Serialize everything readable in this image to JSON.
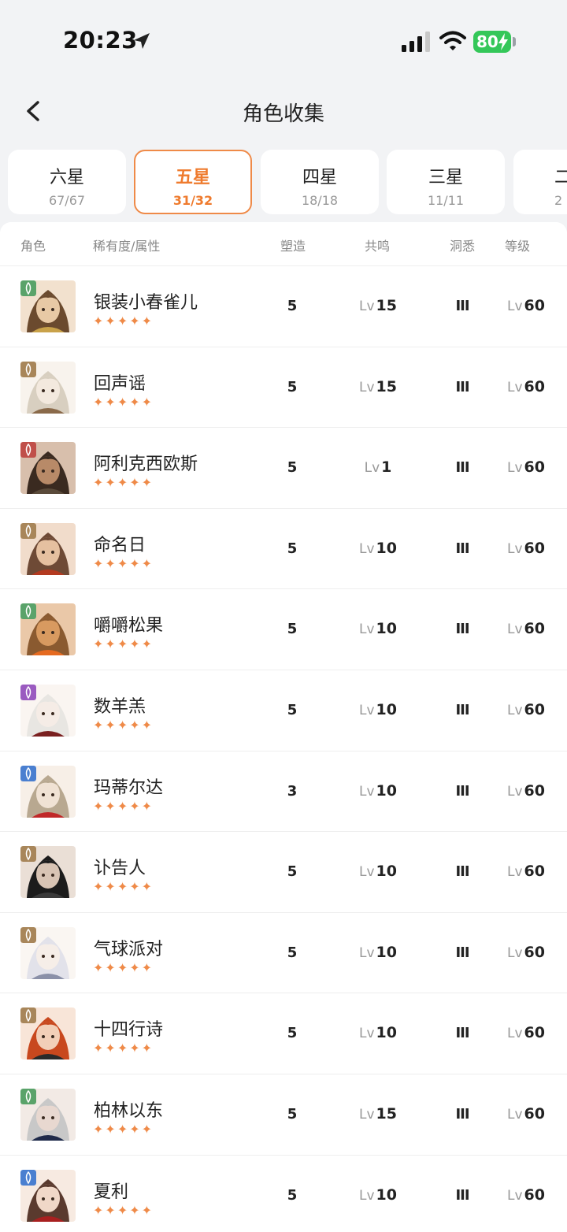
{
  "status_bar": {
    "time": "20:23",
    "battery": "80"
  },
  "nav": {
    "title": "角色收集"
  },
  "tabs": [
    {
      "label": "六星",
      "count": "67/67"
    },
    {
      "label": "五星",
      "count": "31/32"
    },
    {
      "label": "四星",
      "count": "18/18"
    },
    {
      "label": "三星",
      "count": "11/11"
    },
    {
      "label": "二",
      "count": "2"
    }
  ],
  "table": {
    "headers": {
      "role": "角色",
      "rarity": "稀有度/属性",
      "forge": "塑造",
      "resonance": "共鸣",
      "insight": "洞悉",
      "level": "等级"
    },
    "lv_prefix": "Lv",
    "rows": [
      {
        "name": "银装小春雀儿",
        "stars": "✦✦✦✦✦",
        "forge": "5",
        "resonance": "15",
        "insight": "III",
        "level": "60",
        "attribute": "plant",
        "attr_color": "#5aa36a"
      },
      {
        "name": "回声谣",
        "stars": "✦✦✦✦✦",
        "forge": "5",
        "resonance": "15",
        "insight": "III",
        "level": "60",
        "attribute": "mineral",
        "attr_color": "#a8865a"
      },
      {
        "name": "阿利克西欧斯",
        "stars": "✦✦✦✦✦",
        "forge": "5",
        "resonance": "1",
        "insight": "III",
        "level": "60",
        "attribute": "beast",
        "attr_color": "#c0504a"
      },
      {
        "name": "命名日",
        "stars": "✦✦✦✦✦",
        "forge": "5",
        "resonance": "10",
        "insight": "III",
        "level": "60",
        "attribute": "mineral",
        "attr_color": "#a8865a"
      },
      {
        "name": "嚼嚼松果",
        "stars": "✦✦✦✦✦",
        "forge": "5",
        "resonance": "10",
        "insight": "III",
        "level": "60",
        "attribute": "plant",
        "attr_color": "#5aa36a"
      },
      {
        "name": "数羊羔",
        "stars": "✦✦✦✦✦",
        "forge": "5",
        "resonance": "10",
        "insight": "III",
        "level": "60",
        "attribute": "spirit",
        "attr_color": "#9a5bc0"
      },
      {
        "name": "玛蒂尔达",
        "stars": "✦✦✦✦✦",
        "forge": "3",
        "resonance": "10",
        "insight": "III",
        "level": "60",
        "attribute": "star",
        "attr_color": "#4a7fd0"
      },
      {
        "name": "讣告人",
        "stars": "✦✦✦✦✦",
        "forge": "5",
        "resonance": "10",
        "insight": "III",
        "level": "60",
        "attribute": "mineral",
        "attr_color": "#a8865a"
      },
      {
        "name": "气球派对",
        "stars": "✦✦✦✦✦",
        "forge": "5",
        "resonance": "10",
        "insight": "III",
        "level": "60",
        "attribute": "mineral",
        "attr_color": "#a8865a"
      },
      {
        "name": "十四行诗",
        "stars": "✦✦✦✦✦",
        "forge": "5",
        "resonance": "10",
        "insight": "III",
        "level": "60",
        "attribute": "mineral",
        "attr_color": "#a8865a"
      },
      {
        "name": "柏林以东",
        "stars": "✦✦✦✦✦",
        "forge": "5",
        "resonance": "15",
        "insight": "III",
        "level": "60",
        "attribute": "plant",
        "attr_color": "#5aa36a"
      },
      {
        "name": "夏利",
        "stars": "✦✦✦✦✦",
        "forge": "5",
        "resonance": "10",
        "insight": "III",
        "level": "60",
        "attribute": "star",
        "attr_color": "#4a7fd0"
      }
    ]
  }
}
